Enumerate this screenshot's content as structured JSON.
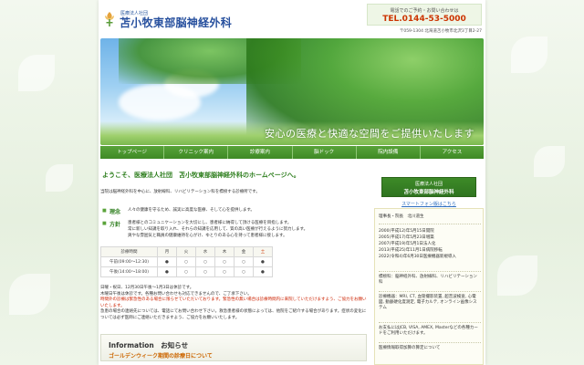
{
  "colors": {
    "brand_green": "#3f8a25",
    "brand_blue": "#27509e",
    "phone_red": "#cc3300",
    "page_bg": "#eaf3e4"
  },
  "header": {
    "logo_icon": "tulip-cross-icon",
    "corp_label": "医療法人社団",
    "hospital_name": "苫小牧東部脳神経外科",
    "contact_note": "電話でのご予約・お問い合わせは",
    "phone": "TEL.0144-53-5000",
    "address": "〒059-1304 北海道苫小牧市北沢3丁目2-27"
  },
  "hero": {
    "tagline": "安心の医療と快適な空間をご提供いたします"
  },
  "nav": {
    "items": [
      "トップページ",
      "クリニック案内",
      "診療案内",
      "脳ドック",
      "院内設備",
      "アクセス"
    ]
  },
  "main": {
    "welcome": "ようこそ、医療法人社団　苫小牧東部脳神経外科のホームページへ。",
    "intro": "当院は脳神経外科を中心に、放射線科、リハビリテーション科を標榜する診療所です。",
    "policy": {
      "rinen_label": "理念",
      "rinen_text": "人々の健康を守るため、誠実に高度な医療、そして心を提供します。",
      "houshin_label": "方針",
      "houshin_lines": [
        "患者様とのコミュニケーションを大切にし、患者様に納得して頂ける医療を目指します。",
        "常に新しい知識を取り入れ、それらの知識を応用して、質の高い医療が行えるように努力します。",
        "爽やな雰囲気と職員の健康維持を心がけ、ゆとりのある心を持って患者様に接します。"
      ]
    },
    "hours_table": {
      "header": [
        "診療時間",
        "月",
        "火",
        "水",
        "木",
        "金",
        "土"
      ],
      "rows": [
        [
          "午前(09:00～12:30)",
          "●",
          "○",
          "○",
          "○",
          "○",
          "●"
        ],
        [
          "午後(14:00～18:00)",
          "●",
          "○",
          "○",
          "○",
          "○",
          "●"
        ]
      ]
    },
    "notes": [
      "日曜・祝日、12月30日午後～1月3日は休診です。",
      "木曜日午後は休診です。各種お問い合わせも対応できませんので、ご了承下さい。",
      "時間外の診療は緊急性のある場合に限らせていただいております。緊急性の無い場合は診療時間内に来院していただけますよう、ご協力をお願いいたします。",
      "急患の場合の連絡先については、電話にてお問い合わせ下さい。救急患者様の状態によっては、他院をご紹介する場合があります。症状の変化については必ず医師にご連絡いただきますよう、ご協力をお願いいたします。"
    ],
    "info": {
      "title": "Information　お知らせ",
      "sub": "ゴールデンウィーク期間の診療日について"
    }
  },
  "side": {
    "badge_line1": "医療法人社団",
    "badge_line2": "苫小牧東部脳神経外科",
    "smartphone_link": "スマートフォン版はこちら",
    "director": "理事長・院長　北川道生",
    "history": [
      "2000(平成12)年5月15日開院",
      "2005(平成17)年5月23日増築",
      "2007(平成19)年5月1日法人化",
      "2013(平成25)年11月1日病院移転",
      "2022(令和4)年6月30日医療機器新規導入"
    ],
    "departments": "標榜科：脳神経外科、放射線科、リハビリテーション科",
    "equipment": "診療機器：MRI, CT, 血管撮影装置, 超音波検査, 心電図, 動脈硬化度測定, 電子カルテ, オンライン画像システム",
    "payment": "お支払にはJCB, VISA, AMEX, Masterなどの各種カードをご利用いただけます。",
    "parking": "医療情報取得加算の算定について"
  }
}
